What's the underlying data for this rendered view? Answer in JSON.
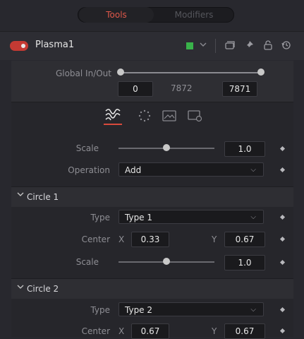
{
  "tabs": {
    "active": "Tools",
    "inactive": "Modifiers"
  },
  "node": {
    "name": "Plasma1",
    "color": "#39b24a"
  },
  "header_icons": [
    "chevron-down-icon",
    "copy-icon",
    "pin-icon",
    "lock-icon",
    "reset-icon"
  ],
  "global_inout": {
    "label": "Global In/Out",
    "in_value": "0",
    "center_value": "7872",
    "out_value": "7871"
  },
  "inspector_tabs": [
    "waves-icon",
    "dots-icon",
    "image-icon",
    "settings-icon"
  ],
  "scale": {
    "label": "Scale",
    "value": "1.0",
    "level": 0.5
  },
  "operation": {
    "label": "Operation",
    "value": "Add"
  },
  "circle1": {
    "title": "Circle 1",
    "type_label": "Type",
    "type_value": "Type 1",
    "center_label": "Center",
    "x_label": "X",
    "x_value": "0.33",
    "y_label": "Y",
    "y_value": "0.67",
    "scale_label": "Scale",
    "scale_value": "1.0",
    "scale_level": 0.5
  },
  "circle2": {
    "title": "Circle 2",
    "type_label": "Type",
    "type_value": "Type 2",
    "center_label": "Center",
    "x_label": "X",
    "x_value": "0.67",
    "y_label": "Y",
    "y_value": "0.67"
  },
  "accent": "#d84a3c"
}
